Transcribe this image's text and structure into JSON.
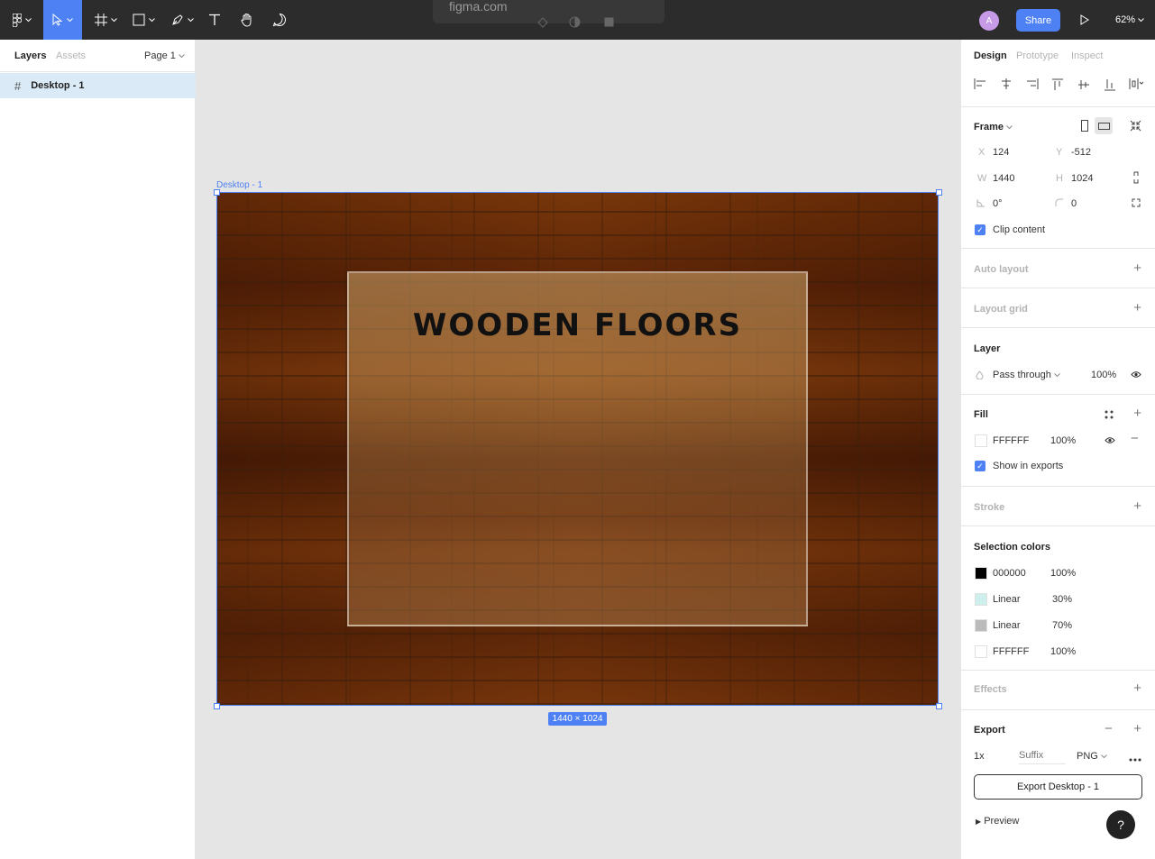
{
  "toolbar": {
    "url_popup": "figma.com",
    "avatar_initial": "A",
    "share_label": "Share",
    "zoom": "62%"
  },
  "left_panel": {
    "tabs": [
      "Layers",
      "Assets"
    ],
    "page": "Page 1",
    "layers": [
      {
        "name": "Desktop - 1"
      }
    ]
  },
  "canvas": {
    "frame_label": "Desktop - 1",
    "title": "WOODEN FLOORS",
    "size_badge": "1440 × 1024"
  },
  "right_panel": {
    "tabs": [
      "Design",
      "Prototype",
      "Inspect"
    ],
    "frame": {
      "title": "Frame",
      "x_label": "X",
      "x": "124",
      "y_label": "Y",
      "y": "-512",
      "w_label": "W",
      "w": "1440",
      "h_label": "H",
      "h": "1024",
      "rotation": "0°",
      "radius": "0",
      "clip_content": "Clip content"
    },
    "auto_layout": "Auto layout",
    "layout_grid": "Layout grid",
    "layer": {
      "title": "Layer",
      "blend": "Pass through",
      "opacity": "100%"
    },
    "fill": {
      "title": "Fill",
      "hex": "FFFFFF",
      "opacity": "100%",
      "show_in_exports": "Show in exports"
    },
    "stroke": "Stroke",
    "selection_colors": {
      "title": "Selection colors",
      "items": [
        {
          "name": "000000",
          "opacity": "100%",
          "swatch": "#000000"
        },
        {
          "name": "Linear",
          "opacity": "30%",
          "swatch": "#cfeeee"
        },
        {
          "name": "Linear",
          "opacity": "70%",
          "swatch": "#bbbbbb"
        },
        {
          "name": "FFFFFF",
          "opacity": "100%",
          "swatch": "#ffffff"
        }
      ]
    },
    "effects": "Effects",
    "export": {
      "title": "Export",
      "scale": "1x",
      "suffix_placeholder": "Suffix",
      "format": "PNG",
      "button": "Export Desktop - 1",
      "preview": "Preview"
    }
  },
  "help_label": "?",
  "colors": {
    "accent": "#4e81f4",
    "toolbar": "#2c2c2c",
    "selected_layer": "#daebf7"
  }
}
